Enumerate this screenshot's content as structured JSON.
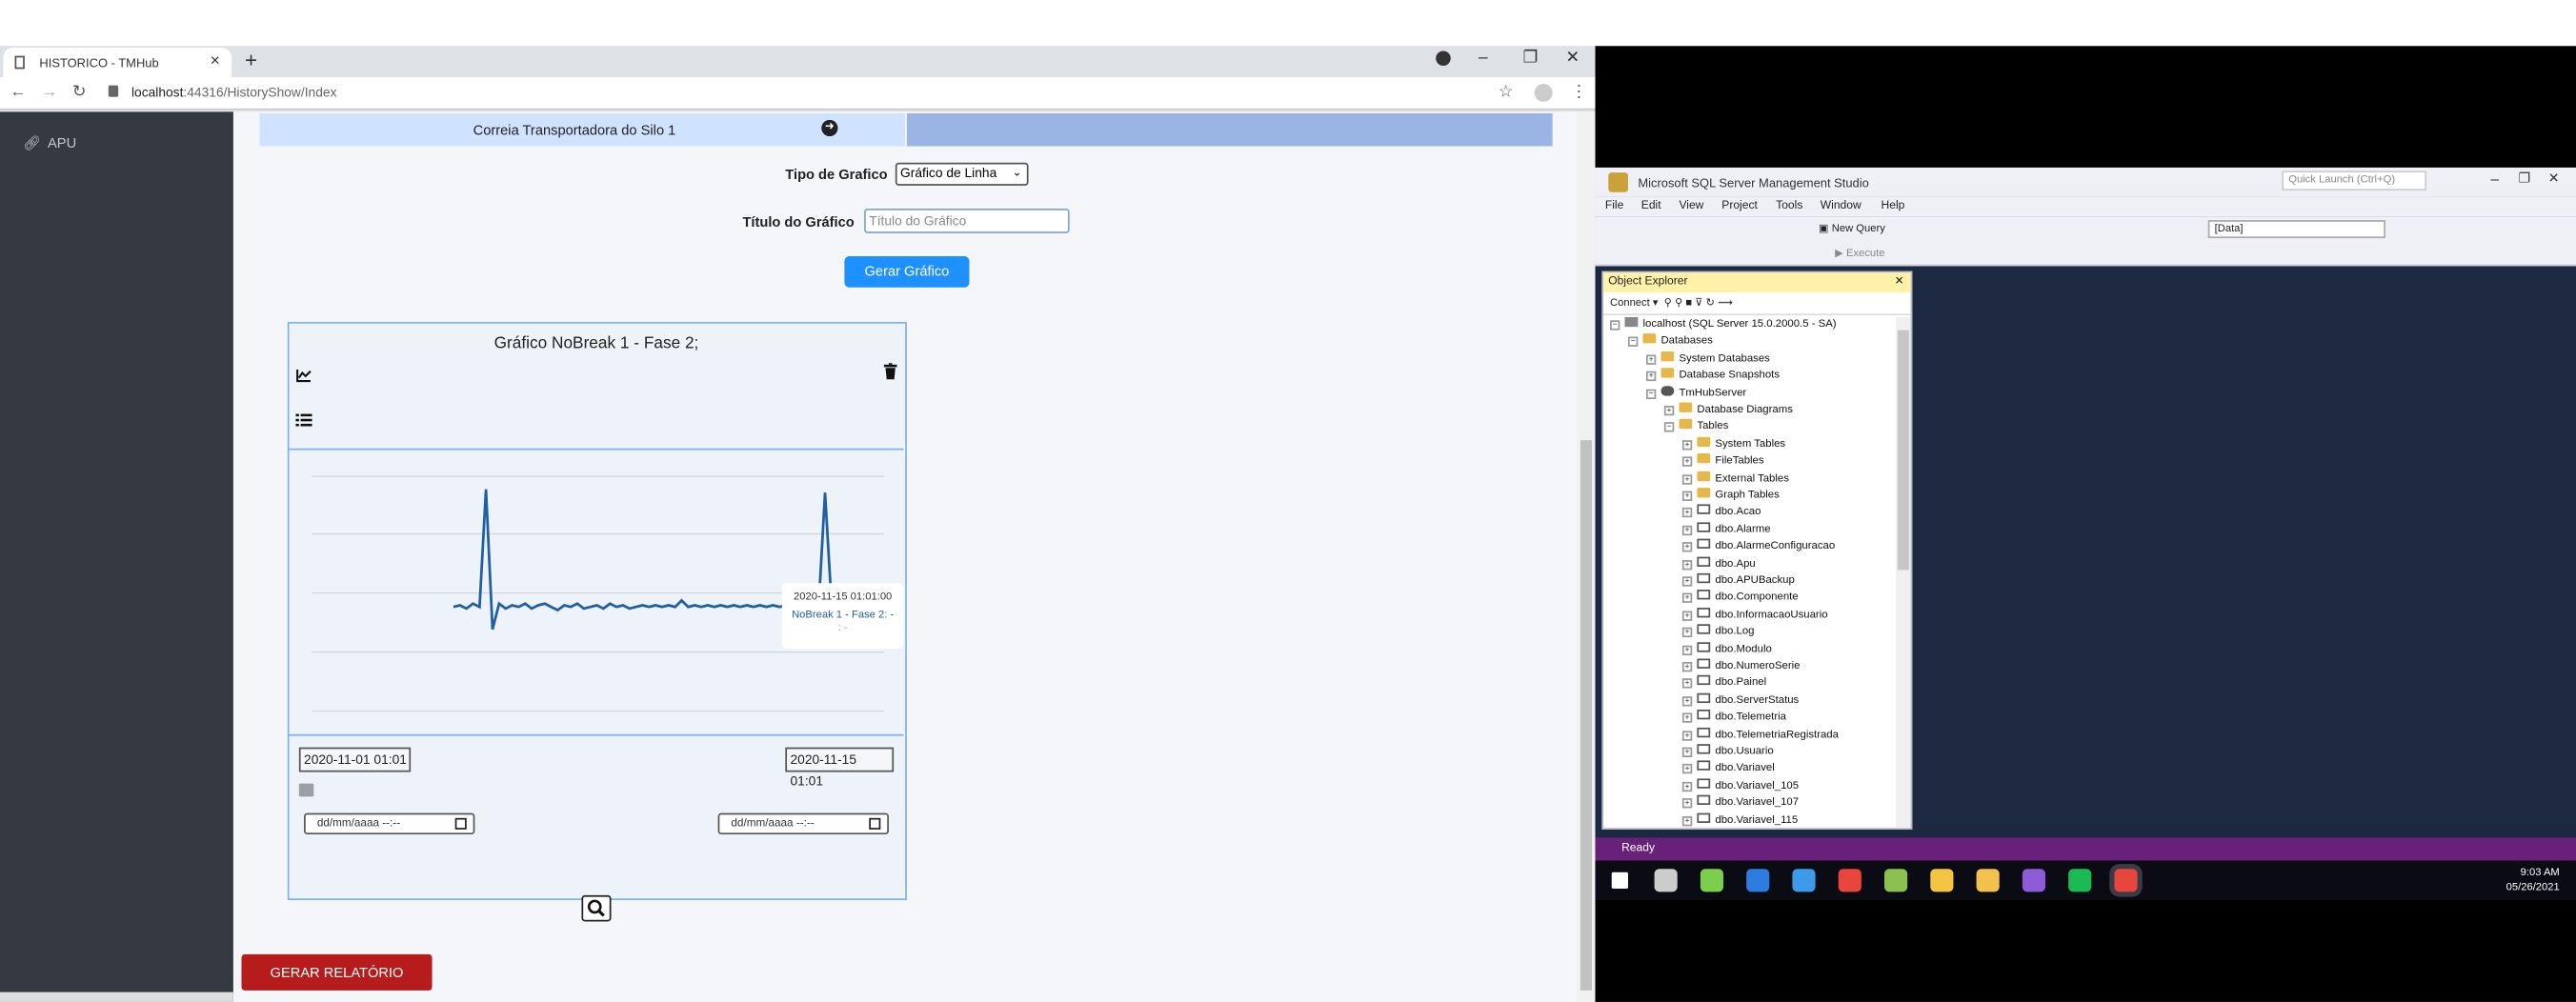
{
  "browser": {
    "tab_title": "HISTORICO - TMHub",
    "new_tab": "+",
    "url_host": "localhost",
    "url_rest": ":44316/HistoryShow/Index"
  },
  "sidebar": {
    "items": [
      {
        "label": "APU",
        "icon": "link-icon"
      }
    ]
  },
  "tabs": {
    "active": "Correia Transportadora do Silo 1"
  },
  "form": {
    "chart_type_label": "Tipo de Grafico",
    "chart_type_value": "Gráfico de Linha",
    "chart_title_label": "Título do Gráfico",
    "chart_title_placeholder": "Título do Gráfico",
    "generate_button": "Gerar Gráfico"
  },
  "card": {
    "title": "Gráfico NoBreak 1 - Fase 2;",
    "start_date": "2020-11-01 01:01",
    "end_date": "2020-11-15 01:01",
    "start_input_placeholder": "dd/mm/aaaa --:--",
    "end_input_placeholder": "dd/mm/aaaa --:--",
    "tooltip": {
      "date": "2020-11-15 01:01:00",
      "series": "NoBreak 1 - Fase 2: -",
      "dots": ": -"
    }
  },
  "chart_data": {
    "type": "line",
    "series": [
      {
        "name": "NoBreak 1 - Fase 2"
      }
    ],
    "color": "#1f5fa6",
    "grid": true,
    "note_values": "unlabeled y-axis; profile shown relative (0-1)",
    "values": [
      0.24,
      0.25,
      0.23,
      0.26,
      0.24,
      0.97,
      0.1,
      0.26,
      0.23,
      0.25,
      0.24,
      0.26,
      0.23,
      0.25,
      0.26,
      0.24,
      0.22,
      0.25,
      0.24,
      0.26,
      0.23,
      0.24,
      0.25,
      0.23,
      0.26,
      0.24,
      0.25,
      0.23,
      0.24,
      0.25,
      0.24,
      0.25,
      0.24,
      0.25,
      0.24,
      0.28,
      0.24,
      0.25,
      0.24,
      0.25,
      0.24,
      0.25,
      0.24,
      0.25,
      0.24,
      0.25,
      0.24,
      0.25,
      0.24,
      0.25,
      0.24,
      0.25,
      0.24,
      0.25,
      0.24,
      0.25,
      0.24,
      0.95,
      0.25,
      0.24,
      0.26,
      0.25,
      0.23,
      0.25,
      0.22,
      0.26
    ]
  },
  "buttons": {
    "report": "GERAR RELATÓRIO"
  },
  "ssms": {
    "title": "Microsoft SQL Server Management Studio",
    "quick_launch": "Quick Launch (Ctrl+Q)",
    "menu": [
      "File",
      "Edit",
      "View",
      "Project",
      "Tools",
      "Window",
      "Help"
    ],
    "toolbar_new_query": "New Query",
    "toolbar_db": "[Data]",
    "toolbar_execute": "Execute",
    "object_explorer": "Object Explorer",
    "connect": "Connect",
    "status": "Ready",
    "tree": [
      {
        "label": "localhost (SQL Server 15.0.2000.5 - SA)",
        "level": 0,
        "icon": "server",
        "exp": "−"
      },
      {
        "label": "Databases",
        "level": 1,
        "icon": "folder",
        "exp": "−"
      },
      {
        "label": "System Databases",
        "level": 2,
        "icon": "folder",
        "exp": "+"
      },
      {
        "label": "Database Snapshots",
        "level": 2,
        "icon": "folder",
        "exp": "+"
      },
      {
        "label": "TmHubServer",
        "level": 2,
        "icon": "db",
        "exp": "−"
      },
      {
        "label": "Database Diagrams",
        "level": 3,
        "icon": "folder",
        "exp": "+"
      },
      {
        "label": "Tables",
        "level": 3,
        "icon": "folder",
        "exp": "−"
      },
      {
        "label": "System Tables",
        "level": 4,
        "icon": "folder",
        "exp": "+"
      },
      {
        "label": "FileTables",
        "level": 4,
        "icon": "folder",
        "exp": "+"
      },
      {
        "label": "External Tables",
        "level": 4,
        "icon": "folder",
        "exp": "+"
      },
      {
        "label": "Graph Tables",
        "level": 4,
        "icon": "folder",
        "exp": "+"
      },
      {
        "label": "dbo.Acao",
        "level": 4,
        "icon": "table",
        "exp": "+"
      },
      {
        "label": "dbo.Alarme",
        "level": 4,
        "icon": "table",
        "exp": "+"
      },
      {
        "label": "dbo.AlarmeConfiguracao",
        "level": 4,
        "icon": "table",
        "exp": "+"
      },
      {
        "label": "dbo.Apu",
        "level": 4,
        "icon": "table",
        "exp": "+"
      },
      {
        "label": "dbo.APUBackup",
        "level": 4,
        "icon": "table",
        "exp": "+"
      },
      {
        "label": "dbo.Componente",
        "level": 4,
        "icon": "table",
        "exp": "+"
      },
      {
        "label": "dbo.InformacaoUsuario",
        "level": 4,
        "icon": "table",
        "exp": "+"
      },
      {
        "label": "dbo.Log",
        "level": 4,
        "icon": "table",
        "exp": "+"
      },
      {
        "label": "dbo.Modulo",
        "level": 4,
        "icon": "table",
        "exp": "+"
      },
      {
        "label": "dbo.NumeroSerie",
        "level": 4,
        "icon": "table",
        "exp": "+"
      },
      {
        "label": "dbo.Painel",
        "level": 4,
        "icon": "table",
        "exp": "+"
      },
      {
        "label": "dbo.ServerStatus",
        "level": 4,
        "icon": "table",
        "exp": "+"
      },
      {
        "label": "dbo.Telemetria",
        "level": 4,
        "icon": "table",
        "exp": "+"
      },
      {
        "label": "dbo.TelemetriaRegistrada",
        "level": 4,
        "icon": "table",
        "exp": "+"
      },
      {
        "label": "dbo.Usuario",
        "level": 4,
        "icon": "table",
        "exp": "+"
      },
      {
        "label": "dbo.Variavel",
        "level": 4,
        "icon": "table",
        "exp": "+"
      },
      {
        "label": "dbo.Variavel_105",
        "level": 4,
        "icon": "table",
        "exp": "+"
      },
      {
        "label": "dbo.Variavel_107",
        "level": 4,
        "icon": "table",
        "exp": "+"
      },
      {
        "label": "dbo.Variavel_115",
        "level": 4,
        "icon": "table",
        "exp": "+"
      }
    ]
  },
  "taskbar": {
    "time": "9:03 AM",
    "date": "05/26/2021",
    "apps": [
      {
        "name": "start",
        "color": "#ffffff"
      },
      {
        "name": "task-view",
        "color": "#cccccc"
      },
      {
        "name": "app-green",
        "color": "#7ccf4c"
      },
      {
        "name": "app-blue",
        "color": "#2d7de0"
      },
      {
        "name": "app-tools",
        "color": "#3c9be8"
      },
      {
        "name": "chrome",
        "color": "#e8453c"
      },
      {
        "name": "notepad-green",
        "color": "#8cc152"
      },
      {
        "name": "app-yellow",
        "color": "#f4c542"
      },
      {
        "name": "file-explorer",
        "color": "#f2c14e"
      },
      {
        "name": "visual-studio",
        "color": "#8e5bd6"
      },
      {
        "name": "spotify",
        "color": "#1db954"
      },
      {
        "name": "chrome-active",
        "color": "#e8453c"
      }
    ]
  }
}
